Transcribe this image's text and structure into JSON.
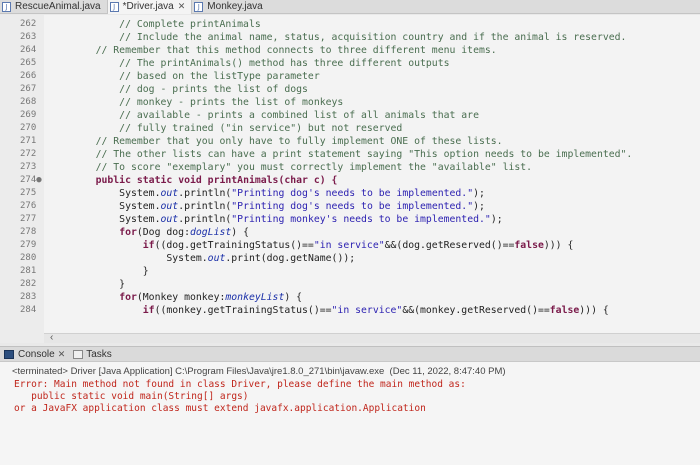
{
  "tabs": [
    {
      "label": "RescueAnimal.java",
      "active": false,
      "closable": false
    },
    {
      "label": "*Driver.java",
      "active": true,
      "closable": true
    },
    {
      "label": "Monkey.java",
      "active": false,
      "closable": false
    }
  ],
  "editor": {
    "lines": [
      {
        "num": "262",
        "text": "        // Complete printAnimals",
        "type": "com"
      },
      {
        "num": "263",
        "text": "        // Include the animal name, status, acquisition country and if the animal is reserved.",
        "type": "com"
      },
      {
        "num": "264",
        "text": "    // Remember that this method connects to three different menu items.",
        "type": "com"
      },
      {
        "num": "265",
        "text": "        // The printAnimals() method has three different outputs",
        "type": "com"
      },
      {
        "num": "266",
        "text": "        // based on the listType parameter",
        "type": "com"
      },
      {
        "num": "267",
        "text": "        // dog - prints the list of dogs",
        "type": "com"
      },
      {
        "num": "268",
        "text": "        // monkey - prints the list of monkeys",
        "type": "com"
      },
      {
        "num": "269",
        "text": "        // available - prints a combined list of all animals that are",
        "type": "com"
      },
      {
        "num": "270",
        "text": "        // fully trained (\"in service\") but not reserved",
        "type": "com"
      },
      {
        "num": "271",
        "text": "    // Remember that you only have to fully implement ONE of these lists.",
        "type": "com"
      },
      {
        "num": "272",
        "text": "    // The other lists can have a print statement saying \"This option needs to be implemented\".",
        "type": "com"
      },
      {
        "num": "273",
        "text": "    // To score \"exemplary\" you must correctly implement the \"available\" list.",
        "type": "com"
      },
      {
        "num": "274●",
        "text": "    public static void printAnimals(char c) {",
        "type": "decl"
      },
      {
        "num": "275",
        "text": "        System.out.println(\"Printing dog's needs to be implemented.\");",
        "type": "print"
      },
      {
        "num": "276",
        "text": "        System.out.println(\"Printing dog's needs to be implemented.\");",
        "type": "print"
      },
      {
        "num": "277",
        "text": "        System.out.println(\"Printing monkey's needs to be implemented.\");",
        "type": "print"
      },
      {
        "num": "278",
        "text": "        for(Dog dog:dogList) {",
        "type": "for"
      },
      {
        "num": "279",
        "text": "            if((dog.getTrainingStatus()==\"in service\"&&(dog.getReserved()==false))) {",
        "type": "if"
      },
      {
        "num": "280",
        "text": "                System.out.print(dog.getName());",
        "type": "plain"
      },
      {
        "num": "281",
        "text": "            }",
        "type": "plain"
      },
      {
        "num": "282",
        "text": "        }",
        "type": "plain"
      },
      {
        "num": "283",
        "text": "        for(Monkey monkey:monkeyList) {",
        "type": "for"
      },
      {
        "num": "284",
        "text": "            if((monkey.getTrainingStatus()==\"in service\"&&(monkey.getReserved()==false))) {",
        "type": "if"
      }
    ]
  },
  "console": {
    "tab_label": "Console",
    "tasks_label": "Tasks",
    "terminated": "<terminated> Driver [Java Application] C:\\Program Files\\Java\\jre1.8.0_271\\bin\\javaw.exe  (Dec 11, 2022, 8:47:40 PM)",
    "error_lines": [
      "Error: Main method not found in class Driver, please define the main method as:",
      "   public static void main(String[] args)",
      "or a JavaFX application class must extend javafx.application.Application"
    ]
  }
}
